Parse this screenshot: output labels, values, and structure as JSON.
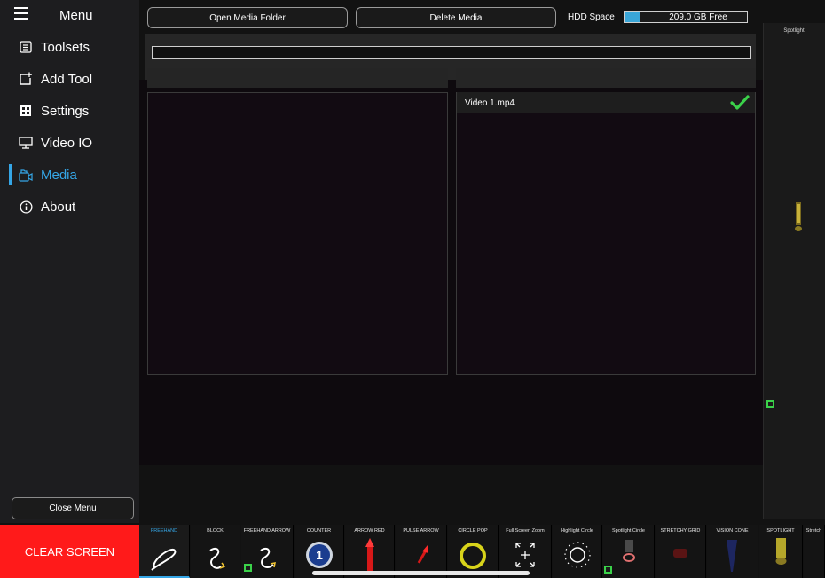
{
  "sidebar": {
    "title": "Menu",
    "items": [
      {
        "label": "Toolsets",
        "icon": "list-icon"
      },
      {
        "label": "Add Tool",
        "icon": "add-square-icon"
      },
      {
        "label": "Settings",
        "icon": "grid-icon"
      },
      {
        "label": "Video IO",
        "icon": "monitor-icon"
      },
      {
        "label": "Media",
        "icon": "media-folder-icon",
        "active": true
      },
      {
        "label": "About",
        "icon": "info-icon"
      }
    ],
    "close_label": "Close Menu"
  },
  "topbar": {
    "open_folder_label": "Open Media Folder",
    "delete_media_label": "Delete Media",
    "hdd_label": "HDD Space",
    "hdd_free": "209.0 GB Free",
    "hdd_used_fraction": 0.12
  },
  "media": {
    "files": [
      {
        "name": "Video 1.mp4",
        "selected": true
      }
    ]
  },
  "right_panel": {
    "title": "Spotlight"
  },
  "toolbar": {
    "clear_label": "CLEAR SCREEN",
    "tools": [
      {
        "label": "FREEHAND",
        "icon": "freehand-icon",
        "active": true
      },
      {
        "label": "BLOCK",
        "icon": "block-icon"
      },
      {
        "label": "FREEHAND ARROW",
        "icon": "freehand-arrow-icon"
      },
      {
        "label": "COUNTER",
        "icon": "counter-icon",
        "counter_value": "1"
      },
      {
        "label": "ARROW RED",
        "icon": "arrow-red-icon"
      },
      {
        "label": "PULSE ARROW",
        "icon": "pulse-arrow-icon"
      },
      {
        "label": "CIRCLE POP",
        "icon": "circle-pop-icon"
      },
      {
        "label": "Full Screen Zoom",
        "icon": "fullscreen-zoom-icon"
      },
      {
        "label": "Highlight Circle",
        "icon": "highlight-circle-icon"
      },
      {
        "label": "Spotlight Circle",
        "icon": "spotlight-circle-icon"
      },
      {
        "label": "STRETCHY GRID",
        "icon": "stretchy-grid-icon"
      },
      {
        "label": "VISION CONE",
        "icon": "vision-cone-icon"
      },
      {
        "label": "SPOTLIGHT",
        "icon": "spotlight-icon"
      },
      {
        "label": "Stretch",
        "icon": "stretch-icon"
      }
    ]
  },
  "colors": {
    "accent": "#35a6e6",
    "clear_red": "#ff1a1a",
    "check_green": "#3bd24a"
  }
}
